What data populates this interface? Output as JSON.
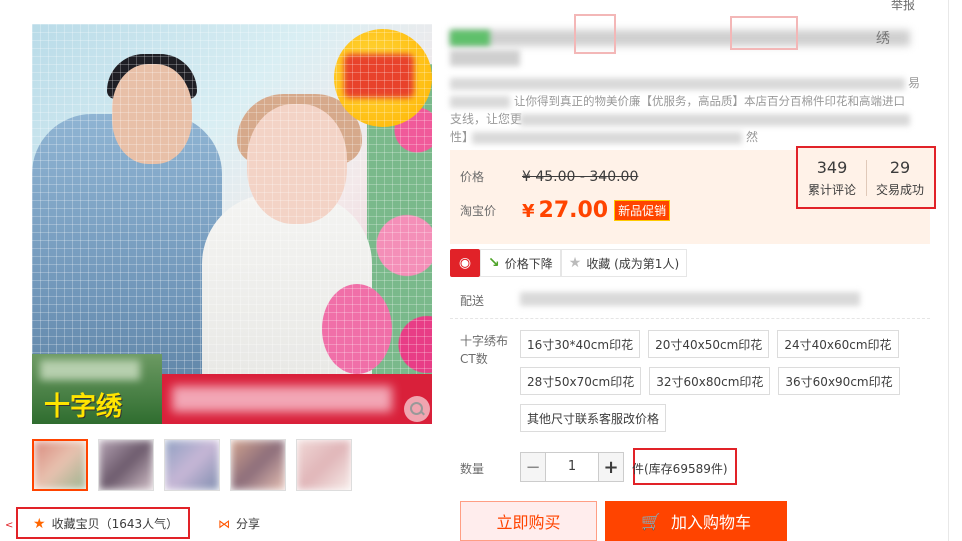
{
  "header": {
    "report_link": "举报"
  },
  "main_image": {
    "banner_text": "十字绣"
  },
  "favorites": {
    "label": "收藏宝贝（1643人气）",
    "icon": "star-icon"
  },
  "share": {
    "label": "分享",
    "icon": "share-icon"
  },
  "title": {
    "tail": "绣"
  },
  "description": {
    "visible_fragments": [
      "易",
      "让你得到真正的物美价廉【优服务，高品质】本店百分百棉件印花和高端进口",
      "支线，让您更",
      "性】",
      "然"
    ]
  },
  "price": {
    "list_label": "价格",
    "list_value": "¥ 45.00 - 340.00",
    "current_label": "淘宝价",
    "currency": "¥",
    "current_value": "27.00",
    "promo_badge": "新品促销"
  },
  "stats": {
    "reviews_count": "349",
    "reviews_label": "累计评论",
    "deals_count": "29",
    "deals_label": "交易成功"
  },
  "actions": {
    "price_drop": "价格下降",
    "collect": "收藏 (成为第1人)"
  },
  "shipping": {
    "label": "配送"
  },
  "sku": {
    "label": "十字绣布CT数",
    "options": [
      "16寸30*40cm印花",
      "20寸40x50cm印花",
      "24寸40x60cm印花",
      "28寸50x70cm印花",
      "32寸60x80cm印花",
      "36寸60x90cm印花",
      "其他尺寸联系客服改价格"
    ]
  },
  "quantity": {
    "label": "数量",
    "value": "1",
    "minus": "−",
    "plus": "+",
    "stock_text": "件(库存69589件)"
  },
  "buttons": {
    "buy_now": "立即购买",
    "add_cart": "加入购物车"
  }
}
